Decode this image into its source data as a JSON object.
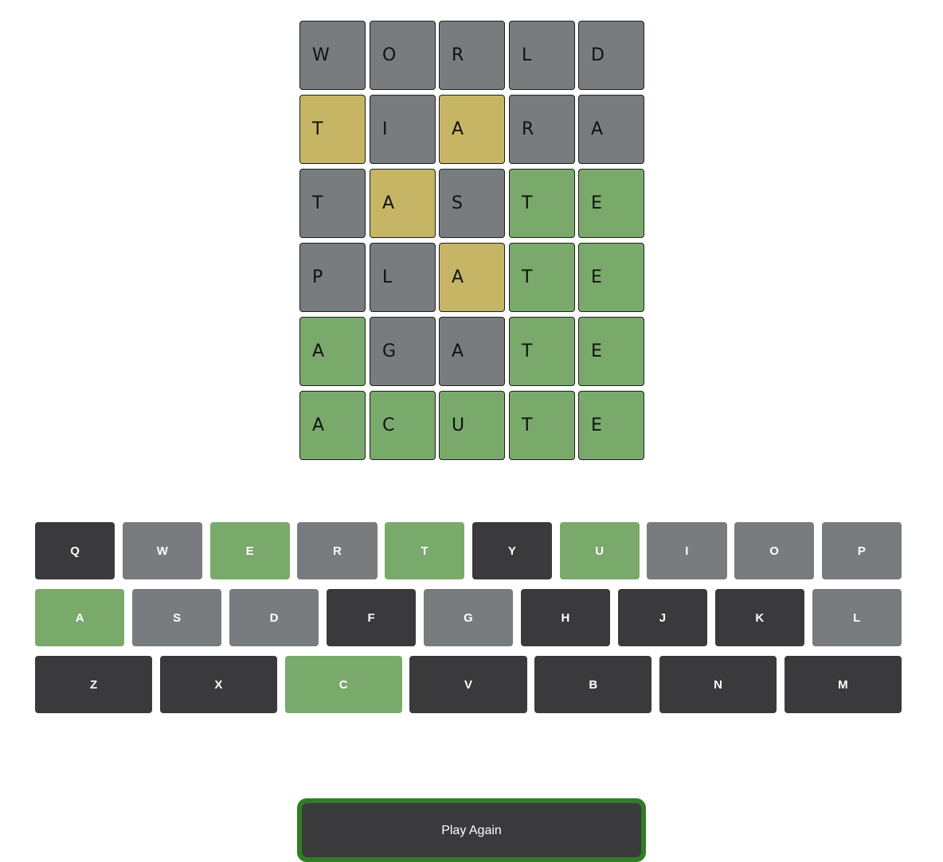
{
  "colors": {
    "absent": "#787c7f",
    "present": "#c5b565",
    "correct": "#79aa6b",
    "key_absent": "#3a3a3c",
    "key_unused": "#787c7f",
    "key_correct": "#79aa6b",
    "button_border": "#2f7d24"
  },
  "board": {
    "rows": [
      [
        {
          "letter": "W",
          "state": "absent"
        },
        {
          "letter": "O",
          "state": "absent"
        },
        {
          "letter": "R",
          "state": "absent"
        },
        {
          "letter": "L",
          "state": "absent"
        },
        {
          "letter": "D",
          "state": "absent"
        }
      ],
      [
        {
          "letter": "T",
          "state": "present"
        },
        {
          "letter": "I",
          "state": "absent"
        },
        {
          "letter": "A",
          "state": "present"
        },
        {
          "letter": "R",
          "state": "absent"
        },
        {
          "letter": "A",
          "state": "absent"
        }
      ],
      [
        {
          "letter": "T",
          "state": "absent"
        },
        {
          "letter": "A",
          "state": "present"
        },
        {
          "letter": "S",
          "state": "absent"
        },
        {
          "letter": "T",
          "state": "correct"
        },
        {
          "letter": "E",
          "state": "correct"
        }
      ],
      [
        {
          "letter": "P",
          "state": "absent"
        },
        {
          "letter": "L",
          "state": "absent"
        },
        {
          "letter": "A",
          "state": "present"
        },
        {
          "letter": "T",
          "state": "correct"
        },
        {
          "letter": "E",
          "state": "correct"
        }
      ],
      [
        {
          "letter": "A",
          "state": "correct"
        },
        {
          "letter": "G",
          "state": "absent"
        },
        {
          "letter": "A",
          "state": "absent"
        },
        {
          "letter": "T",
          "state": "correct"
        },
        {
          "letter": "E",
          "state": "correct"
        }
      ],
      [
        {
          "letter": "A",
          "state": "correct"
        },
        {
          "letter": "C",
          "state": "correct"
        },
        {
          "letter": "U",
          "state": "correct"
        },
        {
          "letter": "T",
          "state": "correct"
        },
        {
          "letter": "E",
          "state": "correct"
        }
      ]
    ]
  },
  "keyboard": {
    "rows": [
      [
        {
          "key": "Q",
          "state": "key_absent"
        },
        {
          "key": "W",
          "state": "key_unused"
        },
        {
          "key": "E",
          "state": "key_correct"
        },
        {
          "key": "R",
          "state": "key_unused"
        },
        {
          "key": "T",
          "state": "key_correct"
        },
        {
          "key": "Y",
          "state": "key_absent"
        },
        {
          "key": "U",
          "state": "key_correct"
        },
        {
          "key": "I",
          "state": "key_unused"
        },
        {
          "key": "O",
          "state": "key_unused"
        },
        {
          "key": "P",
          "state": "key_unused"
        }
      ],
      [
        {
          "key": "A",
          "state": "key_correct"
        },
        {
          "key": "S",
          "state": "key_unused"
        },
        {
          "key": "D",
          "state": "key_unused"
        },
        {
          "key": "F",
          "state": "key_absent"
        },
        {
          "key": "G",
          "state": "key_unused"
        },
        {
          "key": "H",
          "state": "key_absent"
        },
        {
          "key": "J",
          "state": "key_absent"
        },
        {
          "key": "K",
          "state": "key_absent"
        },
        {
          "key": "L",
          "state": "key_unused"
        }
      ],
      [
        {
          "key": "Z",
          "state": "key_absent"
        },
        {
          "key": "X",
          "state": "key_absent"
        },
        {
          "key": "C",
          "state": "key_correct"
        },
        {
          "key": "V",
          "state": "key_absent"
        },
        {
          "key": "B",
          "state": "key_absent"
        },
        {
          "key": "N",
          "state": "key_absent"
        },
        {
          "key": "M",
          "state": "key_absent"
        }
      ]
    ]
  },
  "play_again_label": "Play Again"
}
